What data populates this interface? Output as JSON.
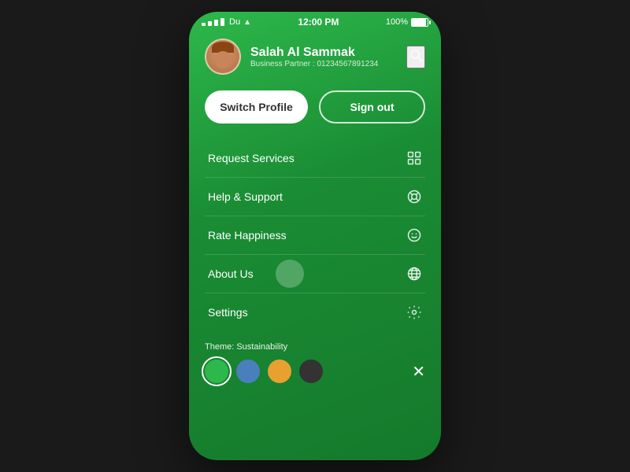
{
  "statusBar": {
    "carrier": "Du",
    "time": "12:00 PM",
    "battery": "100%"
  },
  "profile": {
    "name": "Salah Al Sammak",
    "role": "Business Partner : 01234567891234",
    "avatarAlt": "User avatar"
  },
  "buttons": {
    "switchProfile": "Switch Profile",
    "signOut": "Sign out"
  },
  "menuItems": [
    {
      "id": "request-services",
      "label": "Request Services",
      "icon": "grid"
    },
    {
      "id": "help-support",
      "label": "Help & Support",
      "icon": "lifering"
    },
    {
      "id": "rate-happiness",
      "label": "Rate Happiness",
      "icon": "smiley"
    },
    {
      "id": "about-us",
      "label": "About Us",
      "icon": "globe",
      "active": true
    },
    {
      "id": "settings",
      "label": "Settings",
      "icon": "gear"
    }
  ],
  "theme": {
    "label": "Theme: Sustainability",
    "colors": [
      {
        "id": "green",
        "hex": "#2db84b",
        "active": true
      },
      {
        "id": "blue",
        "hex": "#4a7fbd",
        "active": false
      },
      {
        "id": "orange",
        "hex": "#e8a030",
        "active": false
      },
      {
        "id": "black",
        "hex": "#333333",
        "active": false
      }
    ]
  }
}
